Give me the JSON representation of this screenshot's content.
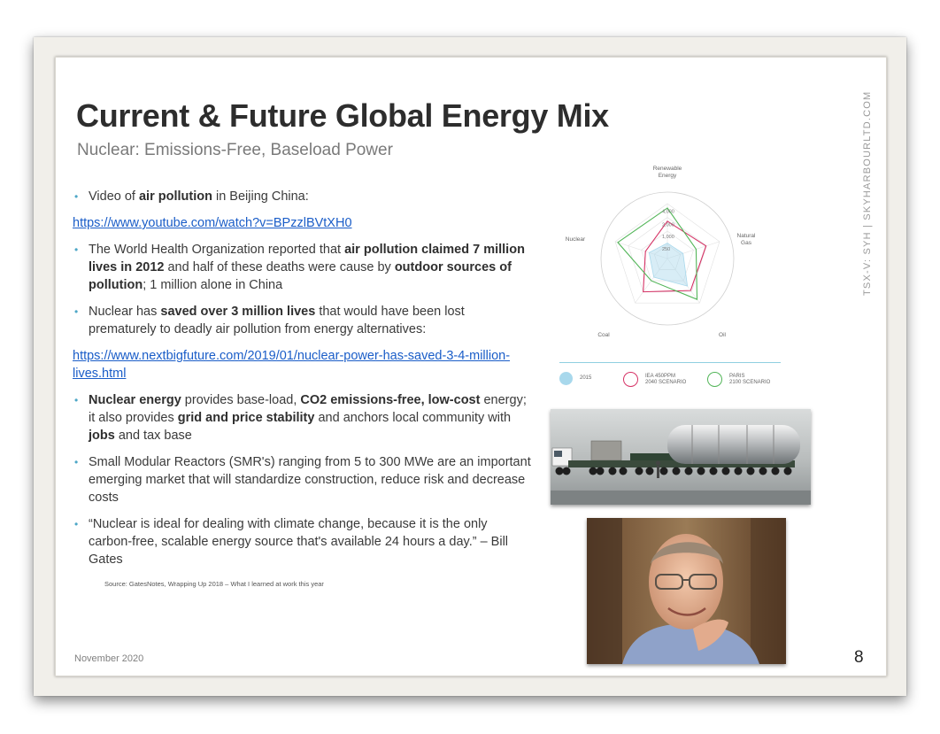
{
  "slide": {
    "title": "Current & Future Global Energy Mix",
    "subtitle": "Nuclear: Emissions-Free, Baseload Power",
    "side_text": "TSX-V: SYH  |  SKYHARBOURLTD.COM",
    "date": "November 2020",
    "page_number": "8"
  },
  "content": {
    "b1": {
      "pre": "Video of ",
      "bold": "air pollution",
      "post": " in Beijing China:"
    },
    "link1": "https://www.youtube.com/watch?v=BPzzlBVtXH0",
    "b2": {
      "t1": "The World Health Organization reported that ",
      "b1": "air pollution claimed 7 million lives in 2012",
      "t2": " and half of these deaths were cause by ",
      "b2": "outdoor sources of pollution",
      "t3": "; 1 million alone in China"
    },
    "b3": {
      "t1": "Nuclear has ",
      "b1": "saved over 3 million lives",
      "t2": " that would have been lost prematurely to deadly air pollution from energy alternatives:"
    },
    "link2": "https://www.nextbigfuture.com/2019/01/nuclear-power-has-saved-3-4-million-lives.html",
    "b4": {
      "b1": "Nuclear energy",
      "t1": " provides base-load, ",
      "b2": "CO2 emissions-free, low-cost",
      "t2": " energy; it also provides ",
      "b3": "grid and price stability",
      "t3": " and anchors local community with ",
      "b4": "jobs",
      "t4": " and tax base"
    },
    "b5": "Small Modular Reactors (SMR's) ranging from 5 to 300 MWe are an important emerging market that will standardize construction, reduce risk and decrease costs",
    "b6": "“Nuclear is ideal for dealing with climate change, because it is the only carbon-free, scalable energy source that's available 24 hours a day.” – Bill Gates",
    "source": "Source: GatesNotes, Wrapping Up 2018 – What I learned at work this year"
  },
  "chart_data": {
    "type": "radar",
    "axes": [
      "Renewable Energy",
      "Natural Gas",
      "Oil",
      "Coal",
      "Nuclear"
    ],
    "axis_label_lines": [
      [
        "Renewable",
        "Energy"
      ],
      [
        "Natural",
        "Gas"
      ],
      [
        "Oil"
      ],
      [
        "Coal"
      ],
      [
        "Nuclear"
      ]
    ],
    "ring_labels": [
      "250",
      "1,000",
      "2,000",
      "4,000"
    ],
    "series": [
      {
        "name": "2015",
        "values": [
          0.28,
          0.3,
          0.62,
          0.42,
          0.35
        ],
        "color": "#a8d8ec",
        "style": "fill"
      },
      {
        "name": "IEA 450PPM 2040 SCENARIO",
        "values": [
          0.68,
          0.74,
          0.72,
          0.75,
          0.42
        ],
        "color": "#d63366",
        "style": "line"
      },
      {
        "name": "PARIS 2100 SCENARIO",
        "values": [
          0.92,
          0.55,
          0.92,
          0.5,
          0.95
        ],
        "color": "#52b558",
        "style": "line"
      }
    ],
    "legend": [
      {
        "label": "2015",
        "color": "#a8d8ec",
        "style": "fill"
      },
      {
        "label_lines": [
          "IEA 450PPM",
          "2040 SCENARIO"
        ],
        "color": "#d63366",
        "style": "ring"
      },
      {
        "label_lines": [
          "PARIS",
          "2100 SCENARIO"
        ],
        "color": "#52b558",
        "style": "ring"
      }
    ],
    "legend_placement": "bottom"
  },
  "colors": {
    "accent": "#4ea7c7",
    "link": "#1a5dc8",
    "title": "#2d2d2d"
  },
  "images": {
    "truck": "smr-transport-truck-image",
    "person": "bill-gates-photo"
  }
}
